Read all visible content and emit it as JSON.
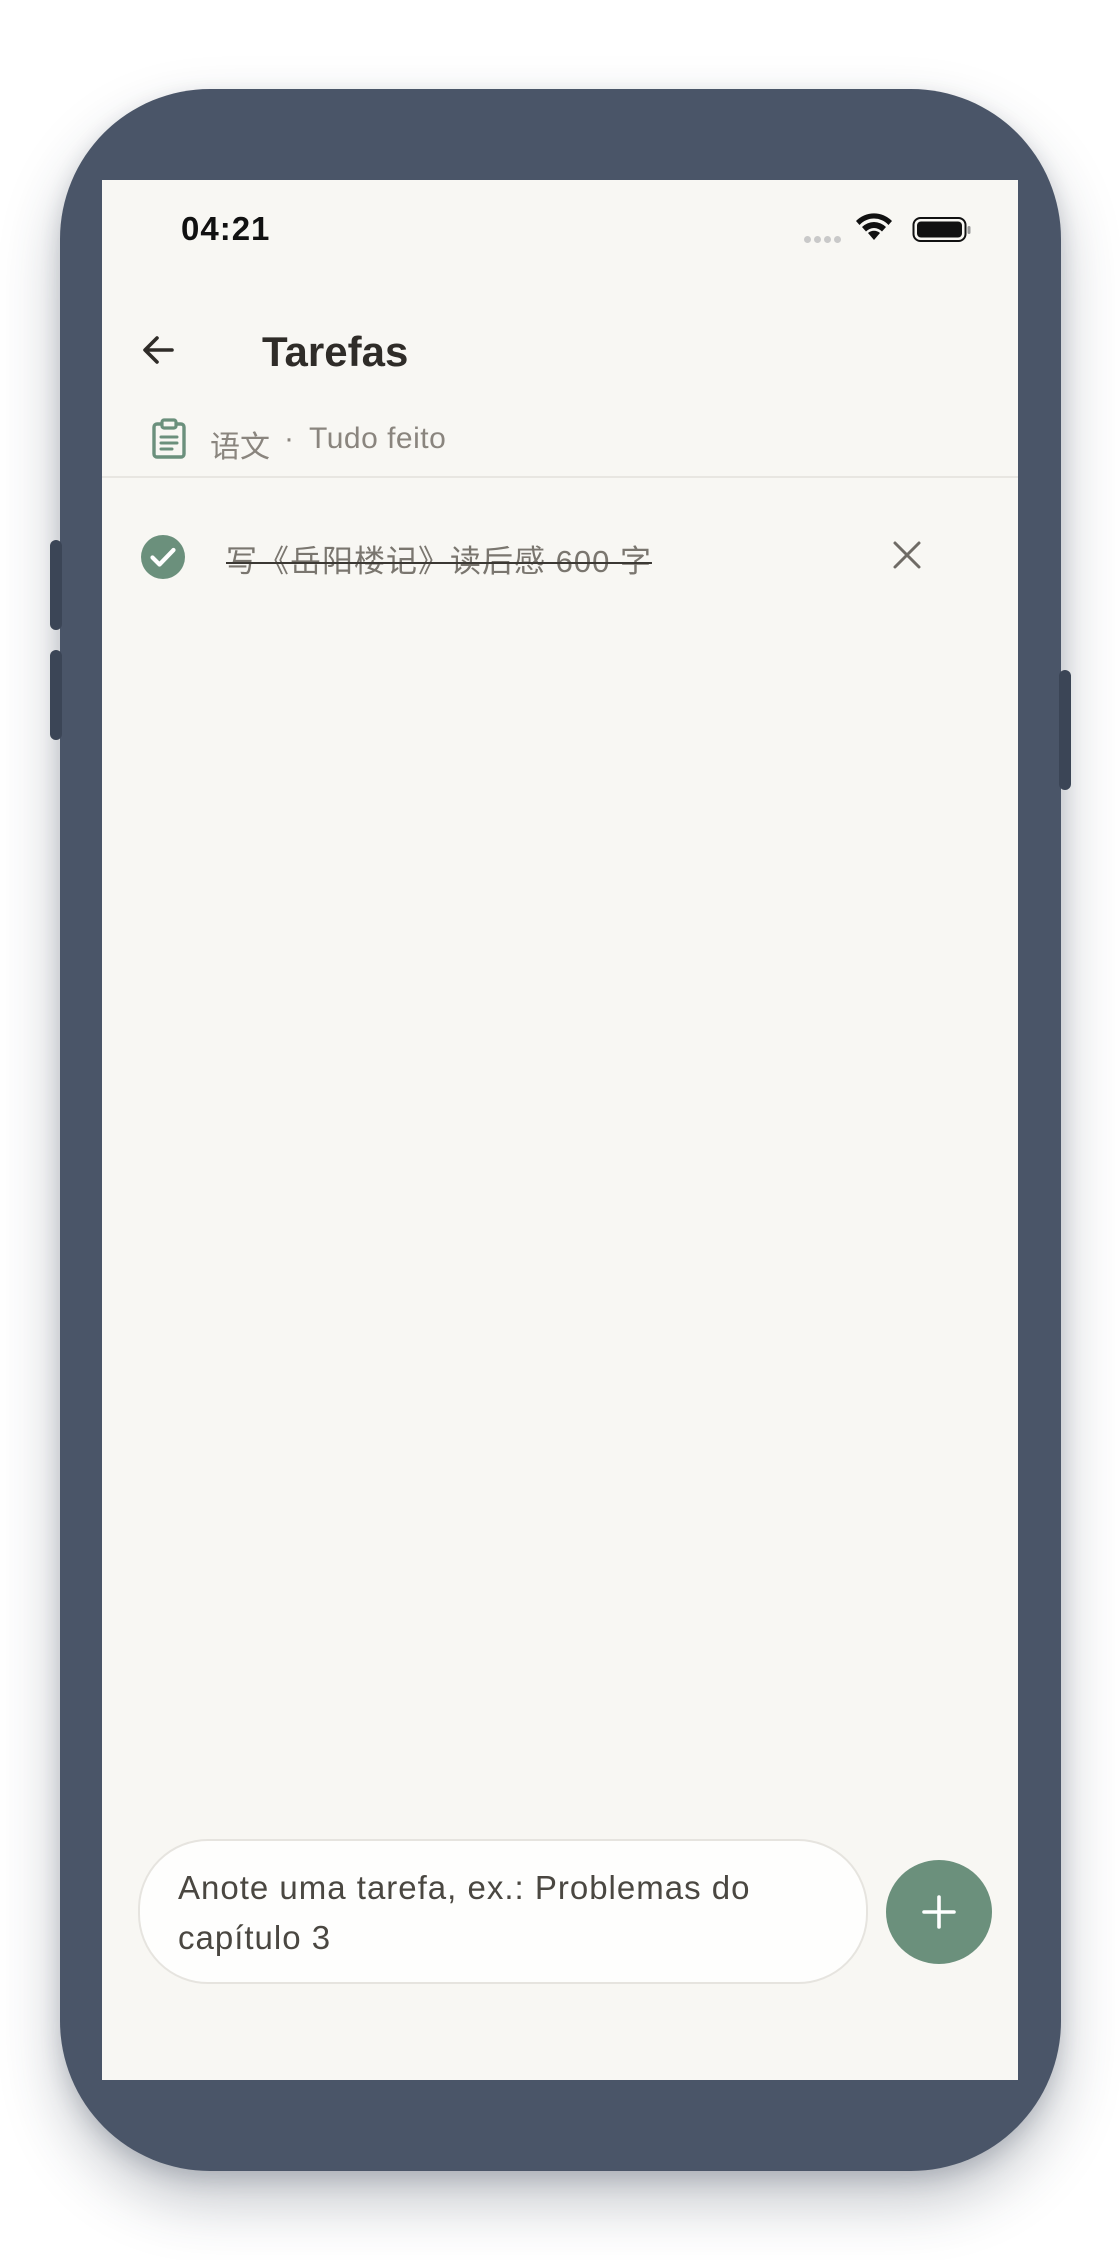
{
  "status_bar": {
    "time": "04:21"
  },
  "header": {
    "title": "Tarefas"
  },
  "subheader": {
    "subject": "语文",
    "separator": "·",
    "status": "Tudo feito"
  },
  "tasks": [
    {
      "text": "写《岳阳楼记》读后感 600 字",
      "done": true
    }
  ],
  "composer": {
    "placeholder": "Anote uma tarefa, ex.: Problemas do capítulo 3"
  },
  "colors": {
    "accent": "#6b907c",
    "background": "#f8f7f3",
    "frame": "#4a5568",
    "muted_text": "#8a857e"
  },
  "icons": {
    "back": "arrow-left-icon",
    "subheader": "clipboard-icon",
    "task_done": "check-circle-icon",
    "delete": "close-icon",
    "add": "plus-icon"
  }
}
